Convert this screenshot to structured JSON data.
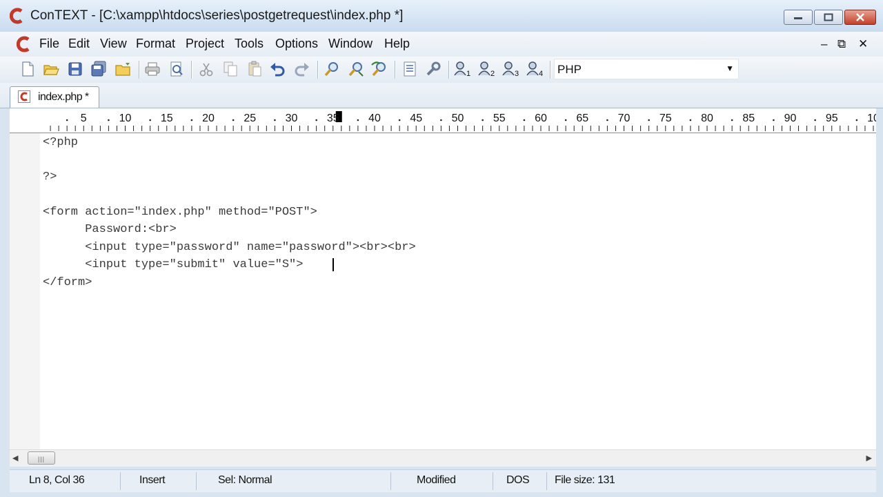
{
  "window": {
    "title": "ConTEXT - [C:\\xampp\\htdocs\\series\\postgetrequest\\index.php *]",
    "accent": "#c0392b"
  },
  "menu": {
    "items": [
      "File",
      "Edit",
      "View",
      "Format",
      "Project",
      "Tools",
      "Options",
      "Window",
      "Help"
    ],
    "mdi_controls": [
      "–",
      "⧉",
      "✕"
    ]
  },
  "toolbar": {
    "icons": [
      "new-file-icon",
      "open-file-icon",
      "save-icon",
      "save-all-icon",
      "open-folder-icon",
      "print-icon",
      "print-preview-icon",
      "cut-icon",
      "copy-icon",
      "paste-icon",
      "undo-icon",
      "redo-icon",
      "find-icon",
      "find-next-icon",
      "replace-icon",
      "document-list-icon",
      "tools-icon",
      "user-tool-1-icon",
      "user-tool-2-icon",
      "user-tool-3-icon",
      "user-tool-4-icon"
    ],
    "language": "PHP"
  },
  "tab": {
    "label": "index.php *"
  },
  "ruler": {
    "labels": [
      "5",
      "10",
      "15",
      "20",
      "25",
      "30",
      "35",
      "40",
      "45",
      "50",
      "55",
      "60",
      "65",
      "70",
      "75",
      "80",
      "85",
      "90",
      "95",
      "10"
    ],
    "current_column": 36
  },
  "editor": {
    "lines": [
      "<?php",
      "",
      "?>",
      "",
      "<form action=\"index.php\" method=\"POST\">",
      "      Password:<br>",
      "      <input type=\"password\" name=\"password\"><br><br>",
      "      <input type=\"submit\" value=\"S\">",
      "</form>"
    ]
  },
  "status": {
    "position": "Ln 8, Col 36",
    "mode": "Insert",
    "selection": "Sel: Normal",
    "modified": "Modified",
    "line_endings": "DOS",
    "file_size": "File size: 131"
  }
}
